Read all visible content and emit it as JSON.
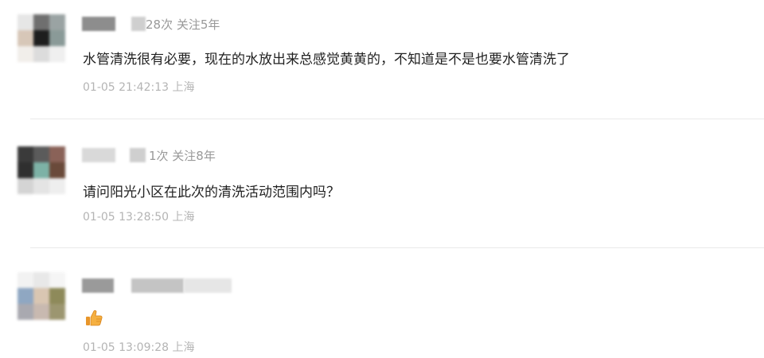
{
  "comments": [
    {
      "meta": "28次 关注5年",
      "text": "水管清洗很有必要，现在的水放出来总感觉黄黄的，不知道是不是也要水管清洗了",
      "time": "01-05 21:42:13 上海"
    },
    {
      "meta": "1次 关注8年",
      "text": "请问阳光小区在此次的清洗活动范围内吗？",
      "time": "01-05 13:28:50 上海"
    },
    {
      "meta": "",
      "emoji": "thumbs-up",
      "time": "01-05 13:09:28 上海"
    }
  ],
  "colors": {
    "text": "#222222",
    "meta": "#999999",
    "time": "#b4b4b4",
    "divider": "#e9e9e9",
    "thumb": "#f0a93a"
  }
}
